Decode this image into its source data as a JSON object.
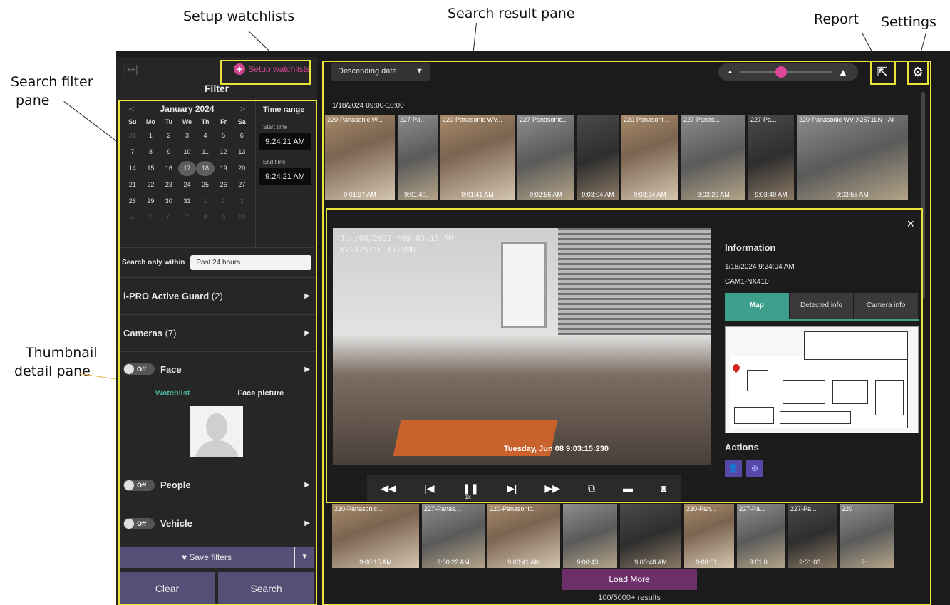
{
  "callouts": {
    "setup_watchlists": "Setup watchlists",
    "search_result_pane": "Search result pane",
    "report": "Report",
    "settings": "Settings",
    "search_filter_pane_line1": "Search filter",
    "search_filter_pane_line2": "pane",
    "thumbnail_detail_pane_line1": "Thumbnail",
    "thumbnail_detail_pane_line2": "detail pane"
  },
  "filter_pane": {
    "setup_link": "Setup watchlists",
    "title": "Filter",
    "calendar": {
      "prev": "<",
      "next": ">",
      "month": "January 2024",
      "days_of_week": [
        "Su",
        "Mo",
        "Tu",
        "We",
        "Th",
        "Fr",
        "Sa"
      ],
      "days": [
        {
          "d": "31",
          "muted": true
        },
        {
          "d": "1"
        },
        {
          "d": "2"
        },
        {
          "d": "3"
        },
        {
          "d": "4"
        },
        {
          "d": "5"
        },
        {
          "d": "6"
        },
        {
          "d": "7"
        },
        {
          "d": "8"
        },
        {
          "d": "9"
        },
        {
          "d": "10"
        },
        {
          "d": "11"
        },
        {
          "d": "12"
        },
        {
          "d": "13"
        },
        {
          "d": "14"
        },
        {
          "d": "15"
        },
        {
          "d": "16"
        },
        {
          "d": "17",
          "sel": true
        },
        {
          "d": "18",
          "sel": true
        },
        {
          "d": "19"
        },
        {
          "d": "20"
        },
        {
          "d": "21"
        },
        {
          "d": "22"
        },
        {
          "d": "23"
        },
        {
          "d": "24"
        },
        {
          "d": "25"
        },
        {
          "d": "26"
        },
        {
          "d": "27"
        },
        {
          "d": "28"
        },
        {
          "d": "29"
        },
        {
          "d": "30"
        },
        {
          "d": "31"
        },
        {
          "d": "1",
          "muted": true
        },
        {
          "d": "2",
          "muted": true
        },
        {
          "d": "3",
          "muted": true
        },
        {
          "d": "4",
          "muted": true
        },
        {
          "d": "5",
          "muted": true
        },
        {
          "d": "6",
          "muted": true
        },
        {
          "d": "7",
          "muted": true
        },
        {
          "d": "8",
          "muted": true
        },
        {
          "d": "9",
          "muted": true
        },
        {
          "d": "10",
          "muted": true
        }
      ]
    },
    "time_range": {
      "title": "Time range",
      "start_label": "Start time",
      "start_value": "9:24:21 AM",
      "end_label": "End time",
      "end_value": "9:24:21 AM"
    },
    "search_within_label": "Search only within",
    "search_within_value": "Past 24 hours",
    "sections": {
      "active_guard": {
        "name": "i-PRO Active Guard",
        "count": "(2)"
      },
      "cameras": {
        "name": "Cameras",
        "count": "(7)"
      },
      "face": {
        "name": "Face",
        "toggle": "Off"
      },
      "people": {
        "name": "People",
        "toggle": "Off"
      },
      "vehicle": {
        "name": "Vehicle",
        "toggle": "Off"
      }
    },
    "face_tabs": {
      "watchlist": "Watchlist",
      "face_picture": "Face picture"
    },
    "save_filters": "Save filters",
    "clear": "Clear",
    "search": "Search"
  },
  "results": {
    "sort": "Descending date",
    "group_label": "1/18/2024 09:00-10:00",
    "top_row": [
      {
        "cam": "220-Panasonic W...",
        "ts": "9:01:37 AM"
      },
      {
        "cam": "227-Pa...",
        "ts": "9:01:40..."
      },
      {
        "cam": "220-Panasonic WV...",
        "ts": "9:01:41 AM"
      },
      {
        "cam": "227-Panasonic...",
        "ts": "9:02:56 AM"
      },
      {
        "cam": "",
        "ts": "9:03:04 AM"
      },
      {
        "cam": "220-Panasoni...",
        "ts": "9:03:24 AM"
      },
      {
        "cam": "227-Panas...",
        "ts": "9:03:29 AM"
      },
      {
        "cam": "227-Pa...",
        "ts": "9:03:49 AM"
      },
      {
        "cam": "220-Panasonic WV-X2571LN - AI",
        "ts": "9:03:55 AM"
      }
    ],
    "bottom_row": [
      {
        "cam": "220-Panasonic...",
        "ts": "9:00:15 AM"
      },
      {
        "cam": "227-Panas...",
        "ts": "9:00:22 AM"
      },
      {
        "cam": "220-Panasonic...",
        "ts": "9:00:41 AM"
      },
      {
        "cam": "",
        "ts": "9:00:43..."
      },
      {
        "cam": "",
        "ts": "9:00:48 AM"
      },
      {
        "cam": "220-Pan...",
        "ts": "9:00:51..."
      },
      {
        "cam": "227-Pa...",
        "ts": "9:01:0..."
      },
      {
        "cam": "227-Pa...",
        "ts": "9:01:03..."
      },
      {
        "cam": "220",
        "ts": "9:..."
      }
    ],
    "load_more": "Load More",
    "results_count": "100/5000+ results"
  },
  "detail": {
    "close": "×",
    "osd_line1": "Jun/08/2021 *09:03:15 AM",
    "osd_line2": "WV-X2571L AI-VMD",
    "video_stamp": "Tuesday, Jun 08 9:03:15:230",
    "speed": "1x",
    "info_title": "Information",
    "datetime": "1/18/2024 9:24:04 AM",
    "camera": "CAM1-NX410",
    "tabs": [
      "Map",
      "Detected info",
      "Camera info"
    ],
    "actions_title": "Actions"
  },
  "colors": {
    "accent_pink": "#d0478f",
    "teal": "#3d9f8c",
    "purple_btn": "#544f76",
    "load_more": "#6c2f6a",
    "highlight_yellow": "#e9e43a"
  }
}
